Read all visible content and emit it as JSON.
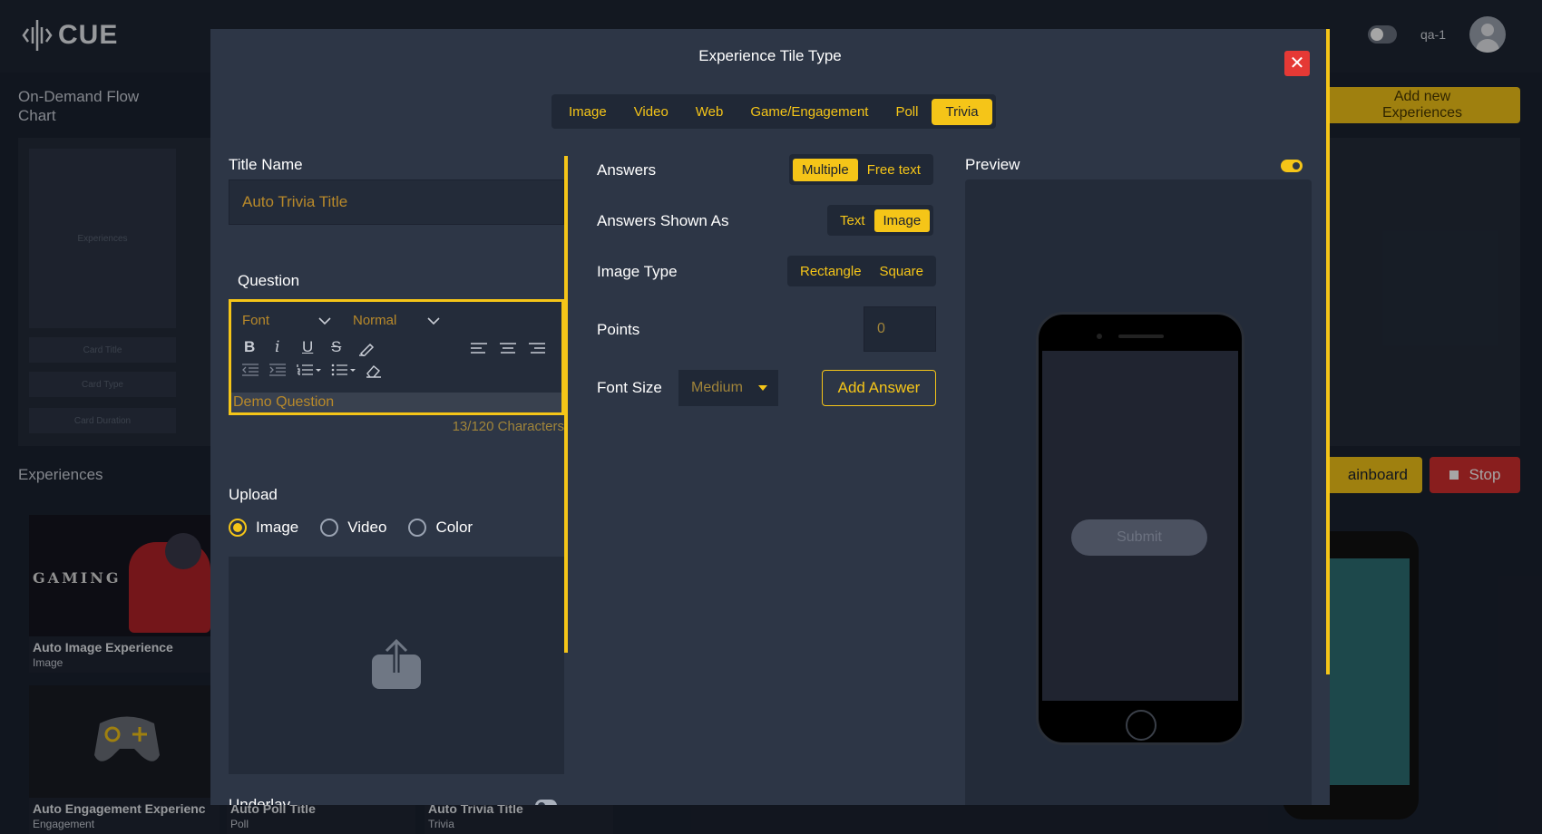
{
  "app": {
    "logo_text": "CUE",
    "user_name": "qa-1"
  },
  "background": {
    "flow_chart_label": "On-Demand Flow\nChart",
    "experiences_label": "Experiences",
    "add_new_label": "Add new\nExperiences",
    "rainboard_label": "ainboard",
    "stop_label": "Stop",
    "field_experiences": "Experiences",
    "field_card_title": "Card Title",
    "field_card_type": "Card Type",
    "field_card_duration": "Card Duration",
    "cards": [
      {
        "title": "Auto Image Experience",
        "type": "Image"
      },
      {
        "title": "Auto Engagement Experienc",
        "type": "Engagement"
      },
      {
        "title": "Auto Poll Title",
        "type": "Poll"
      },
      {
        "title": "Auto Trivia Title",
        "type": "Trivia"
      }
    ],
    "gaming_text": "GAMING"
  },
  "modal": {
    "title": "Experience Tile Type",
    "close_glyph": "✕",
    "tabs": [
      "Image",
      "Video",
      "Web",
      "Game/Engagement",
      "Poll",
      "Trivia"
    ],
    "active_tab": "Trivia",
    "title_name_label": "Title Name",
    "title_name_value": "Auto Trivia Title",
    "question_label": "Question",
    "editor": {
      "font_select": "Font",
      "size_select": "Normal",
      "content": "Demo Question"
    },
    "char_count": "13/120 Characters",
    "upload_label": "Upload",
    "upload_options": [
      "Image",
      "Video",
      "Color"
    ],
    "upload_selected": "Image",
    "underlay_label": "Underlay",
    "answers_label": "Answers",
    "answers_options": [
      "Multiple",
      "Free text"
    ],
    "answers_selected": "Multiple",
    "answers_shown_label": "Answers Shown As",
    "answers_shown_options": [
      "Text",
      "Image"
    ],
    "answers_shown_selected": "Image",
    "image_type_label": "Image Type",
    "image_type_options": [
      "Rectangle",
      "Square"
    ],
    "points_label": "Points",
    "points_value": "0",
    "font_size_label": "Font Size",
    "font_size_value": "Medium",
    "add_answer_label": "Add Answer",
    "preview_label": "Preview",
    "preview_toggle_on": true,
    "submit_label": "Submit"
  },
  "colors": {
    "accent": "#f5c518",
    "danger": "#e53935",
    "modal_bg": "#2d3646",
    "page_bg": "#1b2230"
  }
}
